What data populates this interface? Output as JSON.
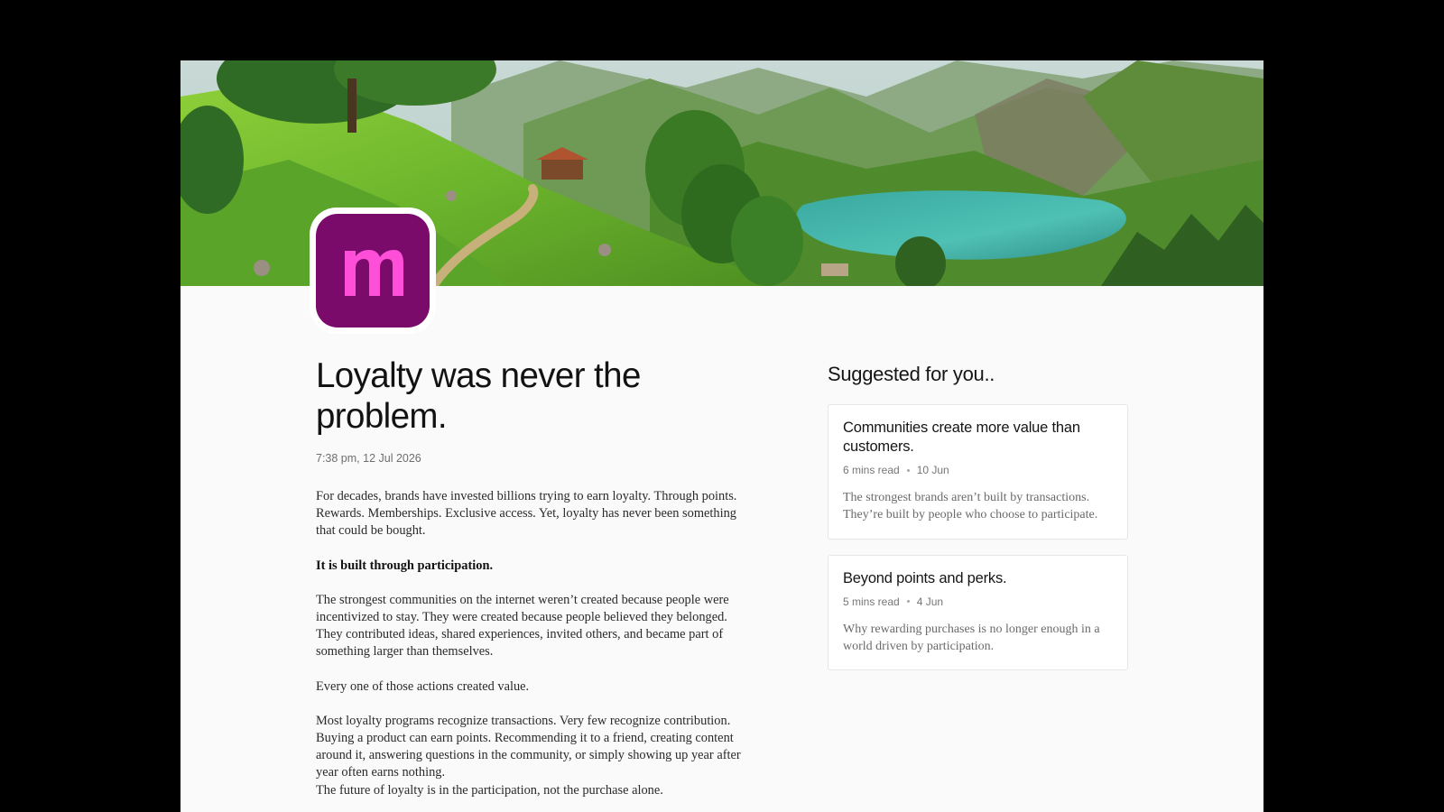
{
  "banner": {
    "alt": "Painted landscape of green hillsides, a wooden cabin and a turquoise mountain lake"
  },
  "logo": {
    "letter": "m",
    "background_color": "#7b0b6b",
    "letter_color": "#ff4fd8"
  },
  "article": {
    "title": "Loyalty was never the problem.",
    "timestamp": "7:38 pm, 12 Jul 2026",
    "paragraphs": [
      "For decades, brands have invested billions trying to earn loyalty. Through points. Rewards. Memberships. Exclusive access. Yet, loyalty has never been something that could be bought.",
      "It is built through participation.",
      "The strongest communities on the internet weren’t created because people were incentivized to stay. They were created because people believed they belonged. They contributed ideas, shared experiences, invited others, and became part of something larger than themselves.",
      "Every one of those actions created value.",
      "Most loyalty programs recognize transactions. Very few recognize contribution.",
      "Buying a product can earn points. Recommending it to a friend, creating content around it, answering questions in the community, or simply showing up year after year often earns nothing.",
      "The future of loyalty is in the participation, not the purchase alone."
    ]
  },
  "suggested": {
    "heading": "Suggested for you..",
    "cards": [
      {
        "title": "Communities create more value than customers.",
        "read_time": "6 mins read",
        "date": "10 Jun",
        "excerpt": "The strongest brands aren’t built by transactions. They’re built by people who choose to participate."
      },
      {
        "title": "Beyond points and perks.",
        "read_time": "5 mins read",
        "date": "4 Jun",
        "excerpt": "Why rewarding purchases is no longer enough in a world driven by participation."
      }
    ]
  }
}
